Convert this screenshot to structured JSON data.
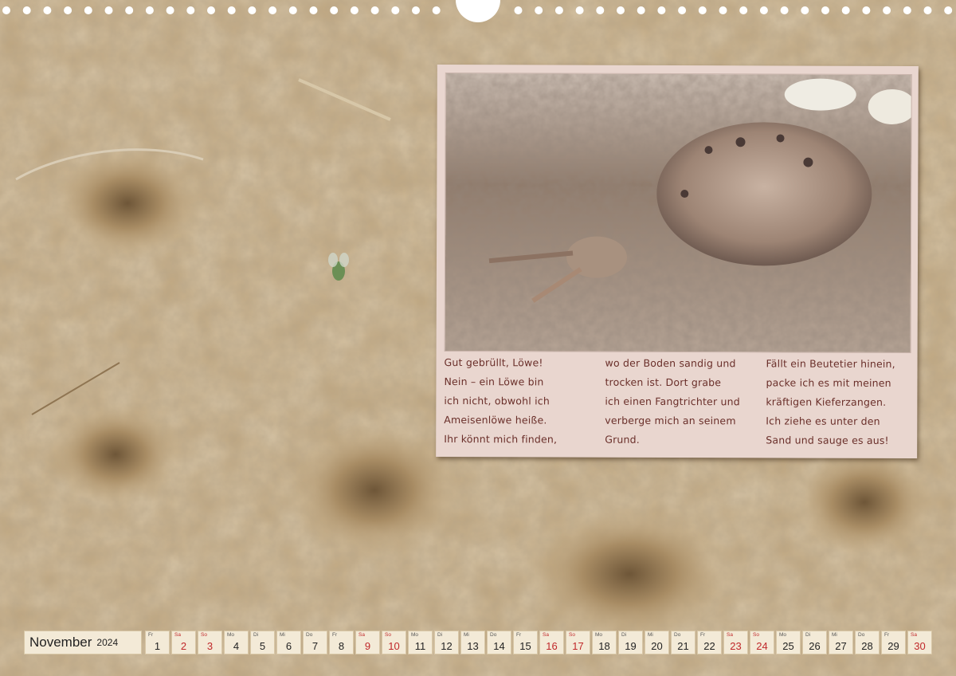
{
  "calendar": {
    "month": "November",
    "year": "2024",
    "days": [
      {
        "wd": "Fr",
        "d": "1",
        "we": false
      },
      {
        "wd": "Sa",
        "d": "2",
        "we": true
      },
      {
        "wd": "So",
        "d": "3",
        "we": true
      },
      {
        "wd": "Mo",
        "d": "4",
        "we": false
      },
      {
        "wd": "Di",
        "d": "5",
        "we": false
      },
      {
        "wd": "Mi",
        "d": "6",
        "we": false
      },
      {
        "wd": "Do",
        "d": "7",
        "we": false
      },
      {
        "wd": "Fr",
        "d": "8",
        "we": false
      },
      {
        "wd": "Sa",
        "d": "9",
        "we": true
      },
      {
        "wd": "So",
        "d": "10",
        "we": true
      },
      {
        "wd": "Mo",
        "d": "11",
        "we": false
      },
      {
        "wd": "Di",
        "d": "12",
        "we": false
      },
      {
        "wd": "Mi",
        "d": "13",
        "we": false
      },
      {
        "wd": "Do",
        "d": "14",
        "we": false
      },
      {
        "wd": "Fr",
        "d": "15",
        "we": false
      },
      {
        "wd": "Sa",
        "d": "16",
        "we": true
      },
      {
        "wd": "So",
        "d": "17",
        "we": true
      },
      {
        "wd": "Mo",
        "d": "18",
        "we": false
      },
      {
        "wd": "Di",
        "d": "19",
        "we": false
      },
      {
        "wd": "Mi",
        "d": "20",
        "we": false
      },
      {
        "wd": "Do",
        "d": "21",
        "we": false
      },
      {
        "wd": "Fr",
        "d": "22",
        "we": false
      },
      {
        "wd": "Sa",
        "d": "23",
        "we": true
      },
      {
        "wd": "So",
        "d": "24",
        "we": true
      },
      {
        "wd": "Mo",
        "d": "25",
        "we": false
      },
      {
        "wd": "Di",
        "d": "26",
        "we": false
      },
      {
        "wd": "Mi",
        "d": "27",
        "we": false
      },
      {
        "wd": "Do",
        "d": "28",
        "we": false
      },
      {
        "wd": "Fr",
        "d": "29",
        "we": false
      },
      {
        "wd": "Sa",
        "d": "30",
        "we": true
      }
    ]
  },
  "card": {
    "col1": "Gut gebrüllt, Löwe!\nNein – ein Löwe bin\nich nicht, obwohl ich\nAmeisenlöwe heiße.\nIhr könnt mich finden,",
    "col2": "wo der Boden sandig und\ntrocken ist. Dort grabe\nich einen Fangtrichter und\nverberge mich an seinem\nGrund.",
    "col3": "Fällt ein Beutetier hinein,\npacke ich es mit meinen\nkräftigen Kieferzangen.\nIch ziehe es unter den\nSand und sauge es aus!"
  },
  "colors": {
    "sand": "#b79d76",
    "card": "#e9d6cf",
    "text": "#6a2f2a",
    "weekend": "#c0282a"
  }
}
